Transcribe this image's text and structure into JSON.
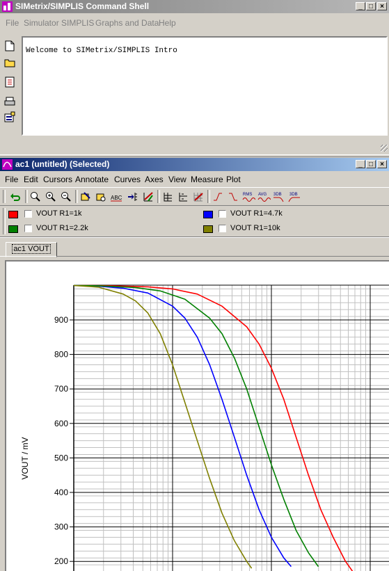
{
  "command_shell": {
    "title": "SIMetrix/SIMPLIS Command Shell",
    "menu": [
      "File",
      "Simulator",
      "SIMPLIS",
      "Graphs and Data",
      "Help"
    ],
    "toolbar_icons": [
      "new-file-icon",
      "open-folder-icon",
      "script-icon",
      "print-icon",
      "options-icon"
    ],
    "console_text": "Welcome to SIMetrix/SIMPLIS Intro"
  },
  "graph_window": {
    "title": "ac1 (untitled) (Selected)",
    "menu": [
      "File",
      "Edit",
      "Cursors",
      "Annotate",
      "Curves",
      "Axes",
      "View",
      "Measure",
      "Plot"
    ],
    "toolbar": {
      "rms_label": "RMS",
      "avg_label": "AVG",
      "db_label": "3DB",
      "db2_label": "3DB"
    },
    "legend": [
      {
        "name": "VOUT R1=1k",
        "color": "#ff0000"
      },
      {
        "name": "VOUT R1=4.7k",
        "color": "#0000ff"
      },
      {
        "name": "VOUT R1=2.2k",
        "color": "#008000"
      },
      {
        "name": "VOUT R1=10k",
        "color": "#808000"
      }
    ],
    "tab_label": "ac1 VOUT"
  },
  "chart_data": {
    "type": "line",
    "ylabel": "VOUT / mV",
    "y_ticks": [
      "900",
      "800",
      "700",
      "600",
      "500",
      "400",
      "300",
      "200"
    ],
    "ylim": [
      185,
      1000
    ],
    "x_scale": "log",
    "grid": true,
    "series": [
      {
        "name": "VOUT R1=1k",
        "color": "#ff0000",
        "points": [
          [
            0.0,
            1000
          ],
          [
            0.15,
            999
          ],
          [
            0.3,
            996
          ],
          [
            0.4,
            990
          ],
          [
            0.5,
            975
          ],
          [
            0.6,
            940
          ],
          [
            0.7,
            880
          ],
          [
            0.75,
            830
          ],
          [
            0.8,
            760
          ],
          [
            0.85,
            670
          ],
          [
            0.9,
            560
          ],
          [
            0.95,
            450
          ],
          [
            1.0,
            350
          ],
          [
            1.05,
            270
          ],
          [
            1.1,
            200
          ],
          [
            1.13,
            170
          ]
        ]
      },
      {
        "name": "VOUT R1=4.7k",
        "color": "#0000ff",
        "points": [
          [
            0.0,
            1000
          ],
          [
            0.1,
            998
          ],
          [
            0.2,
            992
          ],
          [
            0.3,
            978
          ],
          [
            0.4,
            940
          ],
          [
            0.45,
            905
          ],
          [
            0.5,
            850
          ],
          [
            0.55,
            770
          ],
          [
            0.6,
            670
          ],
          [
            0.65,
            560
          ],
          [
            0.7,
            450
          ],
          [
            0.75,
            350
          ],
          [
            0.8,
            270
          ],
          [
            0.85,
            210
          ],
          [
            0.88,
            185
          ]
        ]
      },
      {
        "name": "VOUT R1=2.2k",
        "color": "#008000",
        "points": [
          [
            0.0,
            1000
          ],
          [
            0.1,
            999
          ],
          [
            0.25,
            994
          ],
          [
            0.35,
            984
          ],
          [
            0.45,
            960
          ],
          [
            0.55,
            905
          ],
          [
            0.6,
            860
          ],
          [
            0.65,
            790
          ],
          [
            0.7,
            700
          ],
          [
            0.75,
            590
          ],
          [
            0.8,
            480
          ],
          [
            0.85,
            380
          ],
          [
            0.9,
            290
          ],
          [
            0.95,
            225
          ],
          [
            0.99,
            185
          ]
        ]
      },
      {
        "name": "VOUT R1=10k",
        "color": "#808000",
        "points": [
          [
            0.0,
            1000
          ],
          [
            0.1,
            995
          ],
          [
            0.2,
            975
          ],
          [
            0.25,
            955
          ],
          [
            0.3,
            920
          ],
          [
            0.35,
            860
          ],
          [
            0.4,
            770
          ],
          [
            0.45,
            660
          ],
          [
            0.5,
            550
          ],
          [
            0.55,
            440
          ],
          [
            0.6,
            340
          ],
          [
            0.65,
            260
          ],
          [
            0.7,
            200
          ],
          [
            0.72,
            180
          ]
        ]
      }
    ]
  }
}
